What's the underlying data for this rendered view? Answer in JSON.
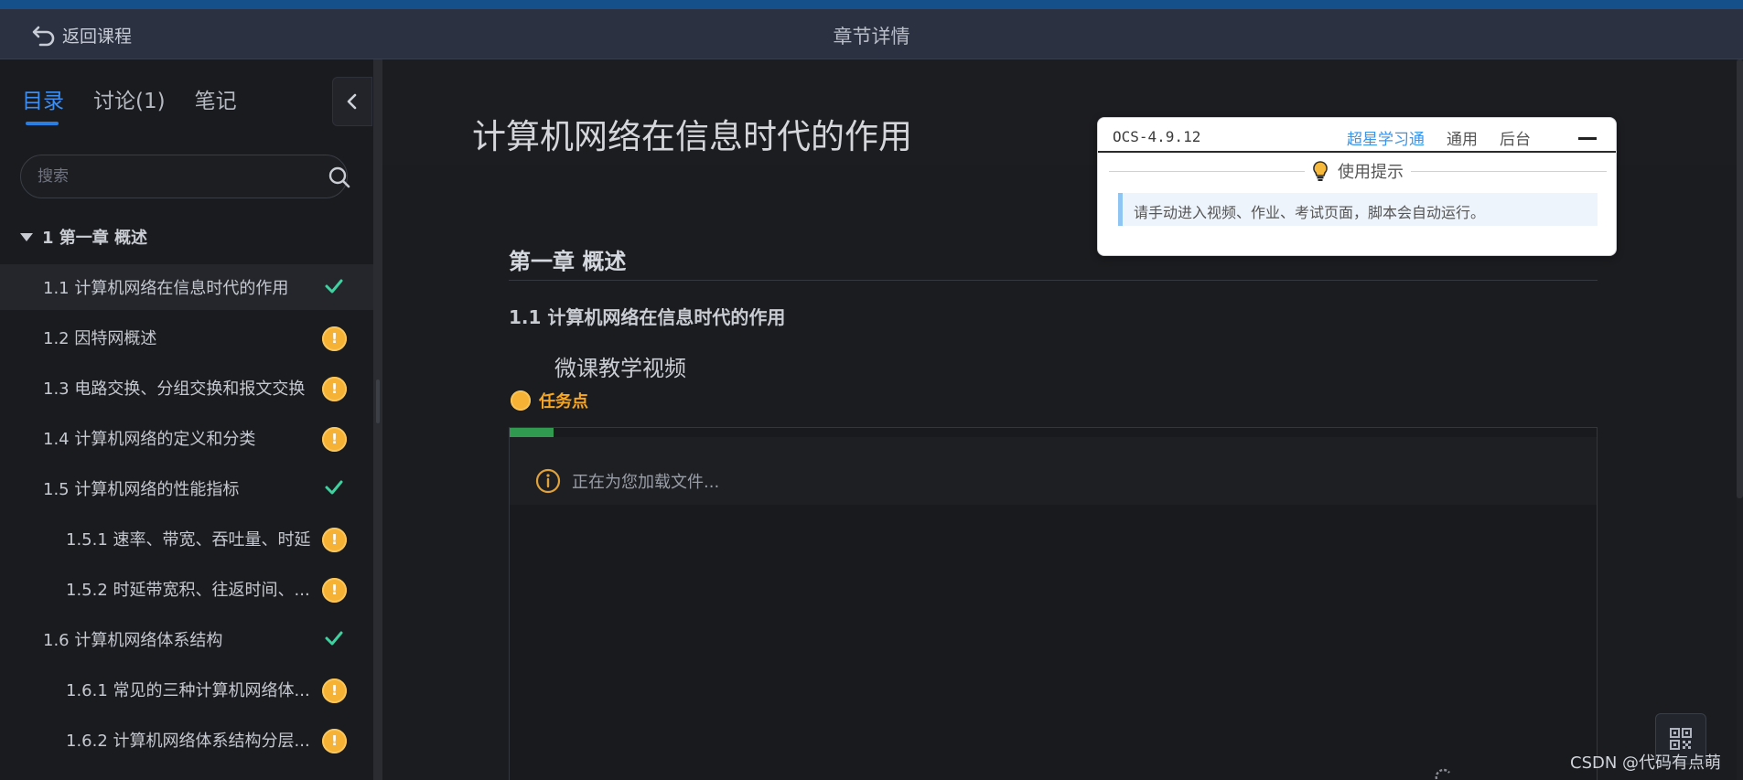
{
  "header": {
    "back_label": "返回课程",
    "title": "章节详情"
  },
  "sidebar": {
    "tabs": [
      {
        "label": "目录",
        "active": true
      },
      {
        "label": "讨论(1)",
        "active": false
      },
      {
        "label": "笔记",
        "active": false
      }
    ],
    "search_placeholder": "搜索",
    "chapter": "1 第一章 概述",
    "items": [
      {
        "label": "1.1 计算机网络在信息时代的作用",
        "status": "done",
        "indent": 0,
        "active": true
      },
      {
        "label": "1.2 因特网概述",
        "status": "pending",
        "indent": 0,
        "active": false
      },
      {
        "label": "1.3 电路交换、分组交换和报文交换",
        "status": "pending",
        "indent": 0,
        "active": false
      },
      {
        "label": "1.4 计算机网络的定义和分类",
        "status": "pending",
        "indent": 0,
        "active": false
      },
      {
        "label": "1.5 计算机网络的性能指标",
        "status": "done",
        "indent": 0,
        "active": false
      },
      {
        "label": "1.5.1 速率、带宽、吞吐量、时延",
        "status": "pending",
        "indent": 1,
        "active": false
      },
      {
        "label": "1.5.2 时延带宽积、往返时间、...",
        "status": "pending",
        "indent": 1,
        "active": false
      },
      {
        "label": "1.6 计算机网络体系结构",
        "status": "done",
        "indent": 0,
        "active": false
      },
      {
        "label": "1.6.1 常见的三种计算机网络体...",
        "status": "pending",
        "indent": 1,
        "active": false
      },
      {
        "label": "1.6.2 计算机网络体系结构分层...",
        "status": "pending",
        "indent": 1,
        "active": false
      }
    ],
    "pending_badge": "!"
  },
  "main": {
    "title": "计算机网络在信息时代的作用",
    "section_heading": "第一章 概述",
    "sub_heading": "1.1 计算机网络在信息时代的作用",
    "video_heading": "微课教学视频",
    "task_point": "任务点",
    "loading_text": "正在为您加载文件...",
    "load_progress": 0.04
  },
  "ocs": {
    "version": "OCS-4.9.12",
    "nav": [
      {
        "label": "超星学习通",
        "active": true
      },
      {
        "label": "通用",
        "active": false
      },
      {
        "label": "后台",
        "active": false
      }
    ],
    "hint_title": "使用提示",
    "hint_text": "请手动进入视频、作业、考试页面，脚本会自动运行。"
  },
  "watermark": "CSDN @代码有点萌",
  "colors": {
    "accent": "#3d8ef0",
    "done": "#3fd2a0",
    "pending": "#f5b234",
    "progress": "#2f9a50"
  }
}
